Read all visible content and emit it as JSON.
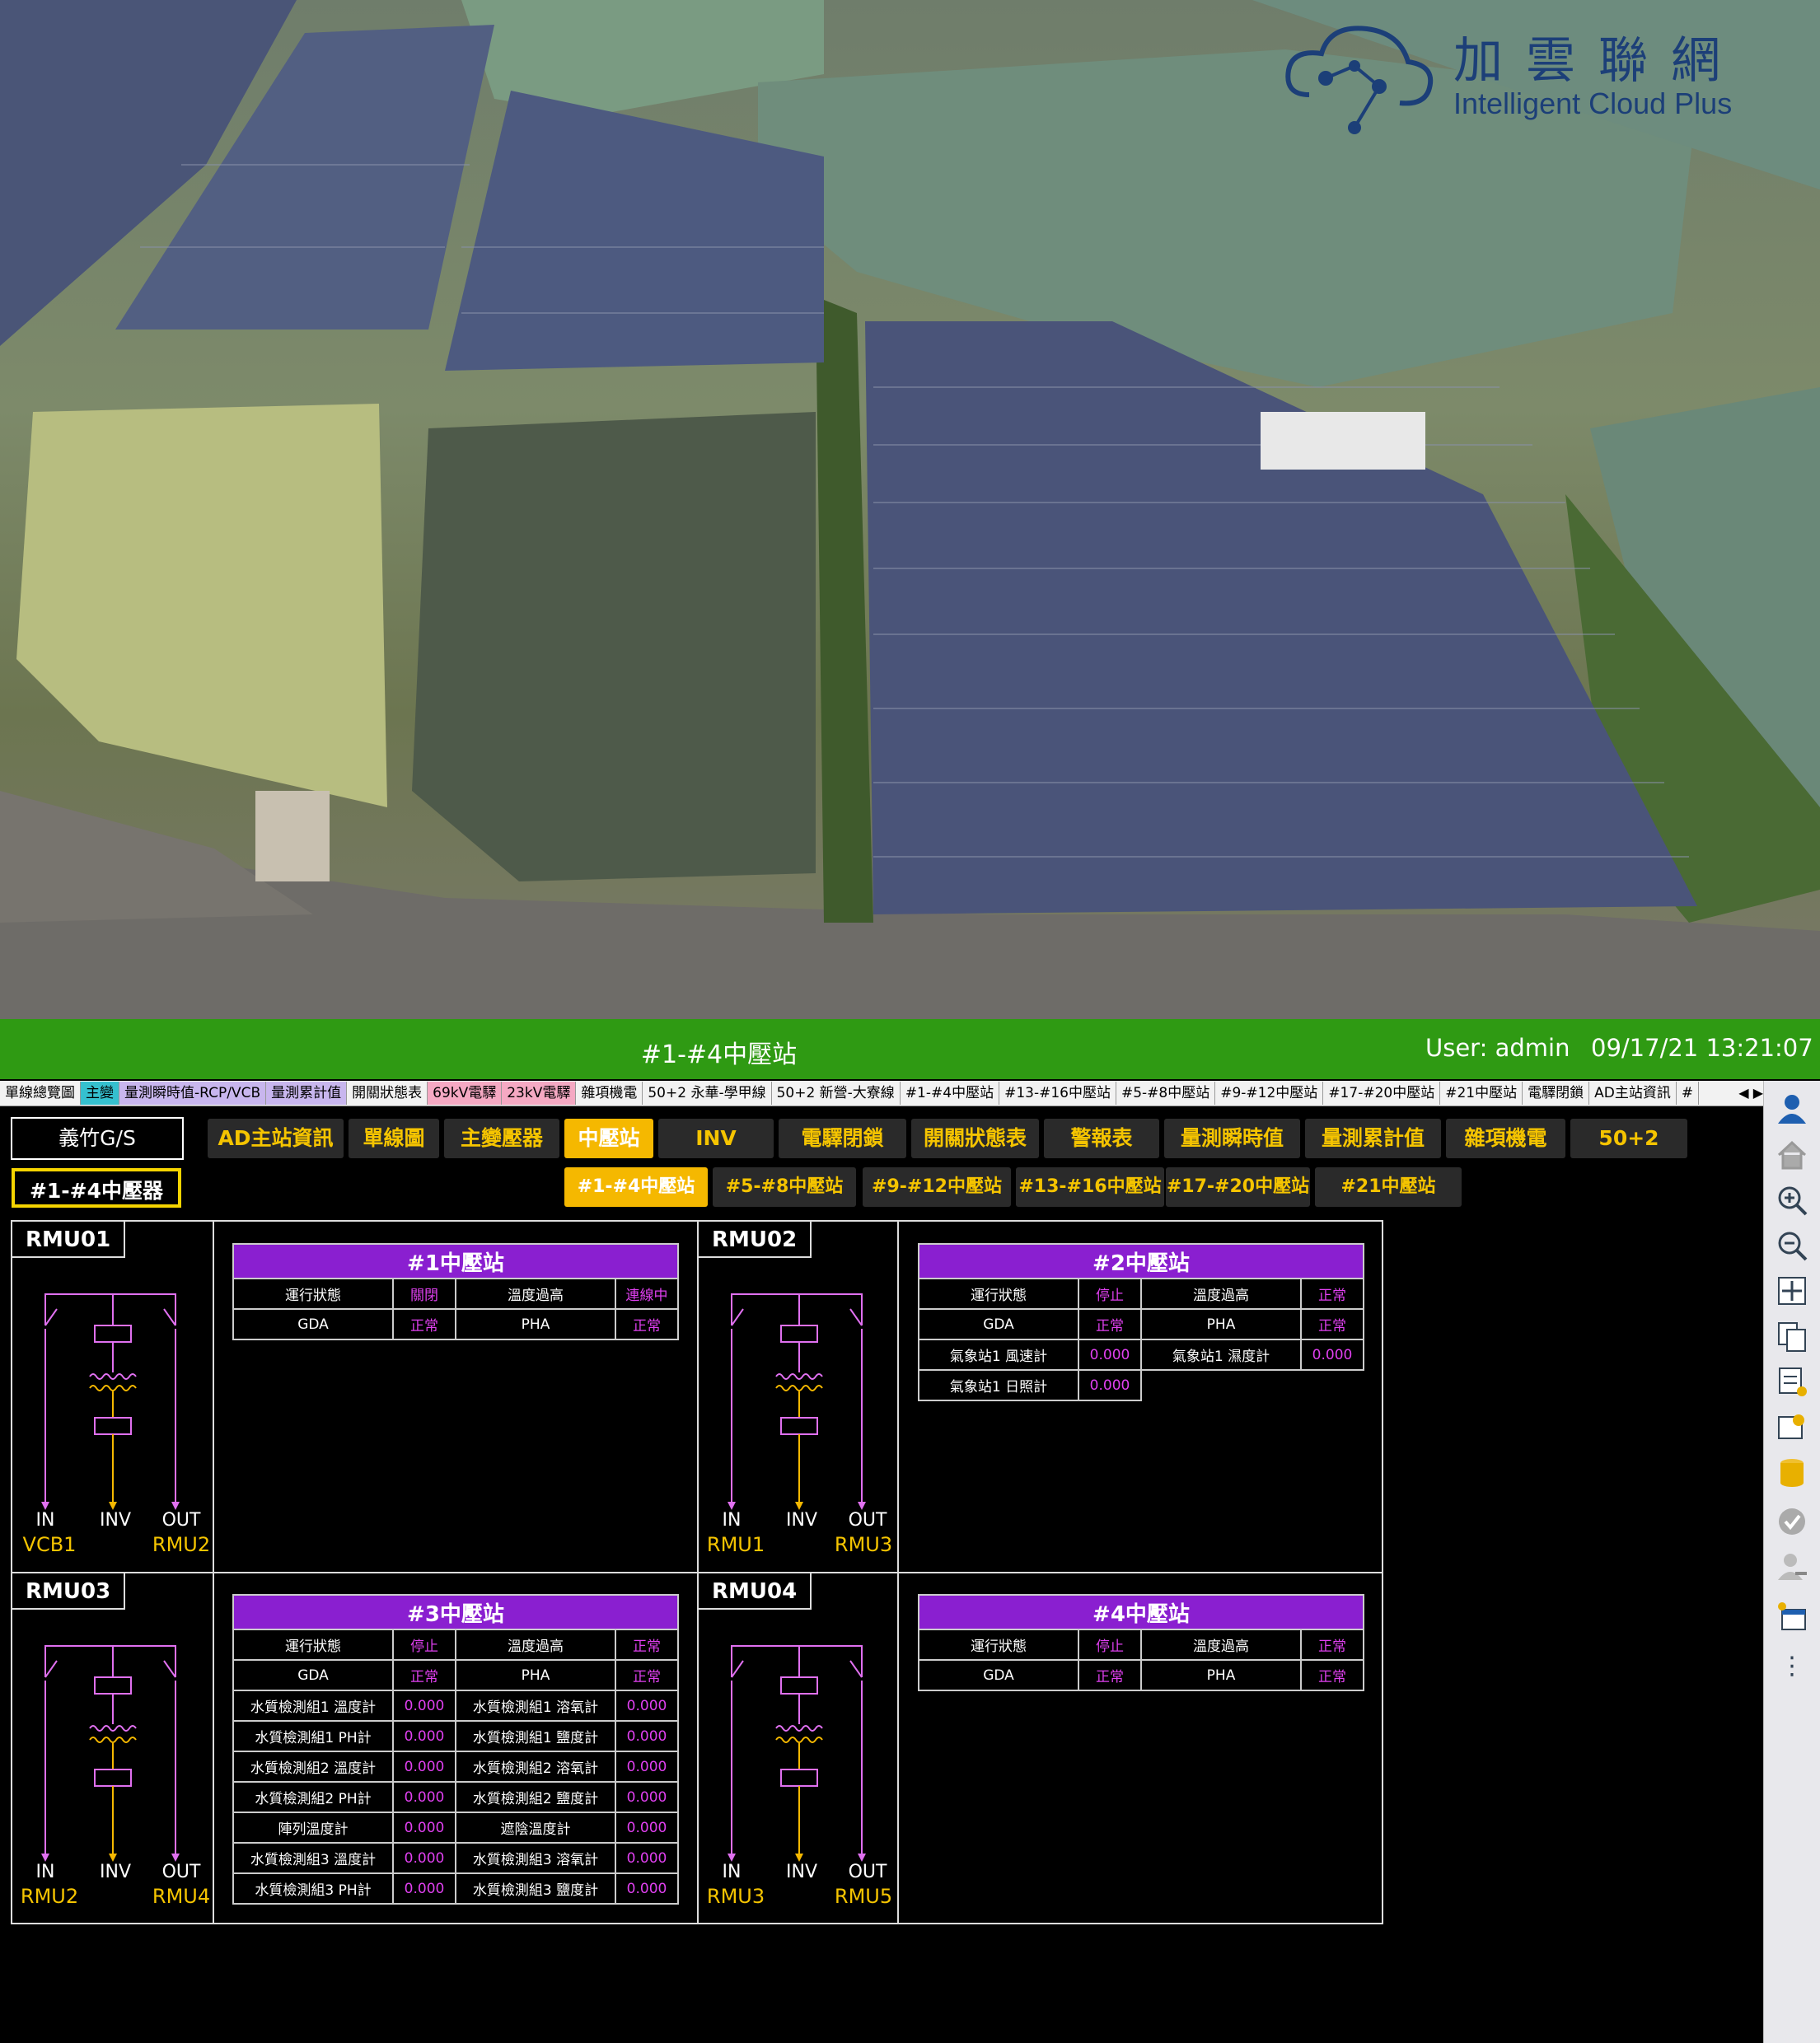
{
  "brand": {
    "name_cn": "加雲聯網",
    "name_en": "Intelligent Cloud Plus"
  },
  "titlebar": {
    "title": "#1-#4中壓站",
    "user": "User: admin",
    "datetime": "09/17/21 13:21:07"
  },
  "tabs": [
    "單線總覽圖",
    "主變",
    "量測瞬時值-RCP/VCB",
    "量測累計值",
    "開關狀態表",
    "69kV電驛",
    "23kV電驛",
    "雜項機電",
    "50+2 永華-學甲線",
    "50+2 新營-大寮線",
    "#1-#4中壓站",
    "#13-#16中壓站",
    "#5-#8中壓站",
    "#9-#12中壓站",
    "#17-#20中壓站",
    "#21中壓站",
    "電驛閉鎖",
    "AD主站資訊",
    "#"
  ],
  "site": {
    "name": "義竹G/S",
    "selected": "#1-#4中壓器"
  },
  "nav": [
    "AD主站資訊",
    "單線圖",
    "主變壓器",
    "中壓站",
    "INV",
    "電驛閉鎖",
    "開關狀態表",
    "警報表",
    "量測瞬時值",
    "量測累計值",
    "雜項機電",
    "50+2"
  ],
  "subnav": [
    "#1-#4中壓站",
    "#5-#8中壓站",
    "#9-#12中壓站",
    "#13-#16中壓站",
    "#17-#20中壓站",
    "#21中壓站"
  ],
  "colors": {
    "titlebar": "#2f9a13",
    "accent": "#f5b800",
    "value": "#e040f0",
    "table_header": "#8a1fd0",
    "diagram": "#e070f0"
  },
  "rmu": [
    {
      "name": "RMU01",
      "in": "IN",
      "inv": "INV",
      "out": "OUT",
      "left": "VCB1",
      "right": "RMU2"
    },
    {
      "name": "RMU02",
      "in": "IN",
      "inv": "INV",
      "out": "OUT",
      "left": "RMU1",
      "right": "RMU3"
    },
    {
      "name": "RMU03",
      "in": "IN",
      "inv": "INV",
      "out": "OUT",
      "left": "RMU2",
      "right": "RMU4"
    },
    {
      "name": "RMU04",
      "in": "IN",
      "inv": "INV",
      "out": "OUT",
      "left": "RMU3",
      "right": "RMU5"
    }
  ],
  "stations": [
    {
      "title": "#1中壓站",
      "rows": [
        [
          "運行狀態",
          "關閉",
          "溫度過高",
          "連線中"
        ],
        [
          "GDA",
          "正常",
          "PHA",
          "正常"
        ]
      ]
    },
    {
      "title": "#2中壓站",
      "rows": [
        [
          "運行狀態",
          "停止",
          "溫度過高",
          "正常"
        ],
        [
          "GDA",
          "正常",
          "PHA",
          "正常"
        ],
        [
          "氣象站1 風速計",
          "0.000",
          "氣象站1 濕度計",
          "0.000"
        ],
        [
          "氣象站1 日照計",
          "0.000"
        ]
      ]
    },
    {
      "title": "#3中壓站",
      "rows": [
        [
          "運行狀態",
          "停止",
          "溫度過高",
          "正常"
        ],
        [
          "GDA",
          "正常",
          "PHA",
          "正常"
        ],
        [
          "水質檢測組1 溫度計",
          "0.000",
          "水質檢測組1 溶氧計",
          "0.000"
        ],
        [
          "水質檢測組1 PH計",
          "0.000",
          "水質檢測組1 鹽度計",
          "0.000"
        ],
        [
          "水質檢測組2 溫度計",
          "0.000",
          "水質檢測組2 溶氧計",
          "0.000"
        ],
        [
          "水質檢測組2 PH計",
          "0.000",
          "水質檢測組2 鹽度計",
          "0.000"
        ],
        [
          "陣列溫度計",
          "0.000",
          "遮陰溫度計",
          "0.000"
        ],
        [
          "水質檢測組3 溫度計",
          "0.000",
          "水質檢測組3 溶氧計",
          "0.000"
        ],
        [
          "水質檢測組3 PH計",
          "0.000",
          "水質檢測組3 鹽度計",
          "0.000"
        ]
      ]
    },
    {
      "title": "#4中壓站",
      "rows": [
        [
          "運行狀態",
          "停止",
          "溫度過高",
          "正常"
        ],
        [
          "GDA",
          "正常",
          "PHA",
          "正常"
        ]
      ]
    }
  ],
  "sidebar_icons": [
    "user-icon",
    "home-icon",
    "zoom-in-icon",
    "zoom-out-icon",
    "fit-screen-icon",
    "window-list-icon",
    "report-icon",
    "settings-window-icon",
    "database-icon",
    "check-icon",
    "user-remove-icon",
    "new-window-icon",
    "more-icon"
  ]
}
